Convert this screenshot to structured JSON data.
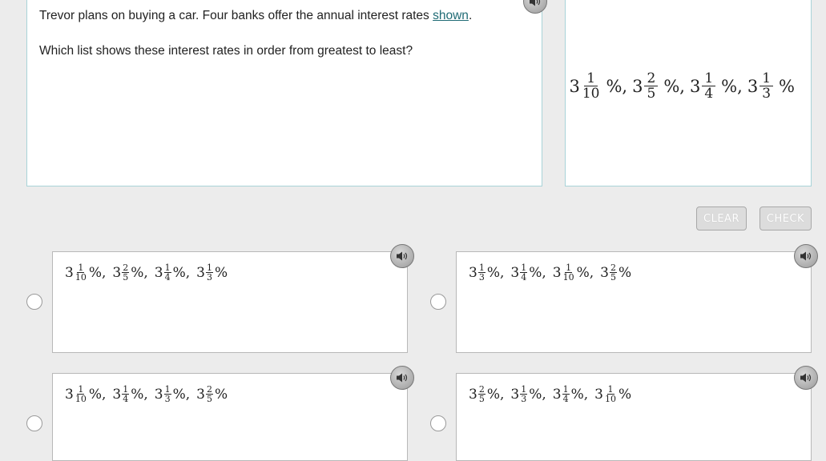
{
  "question": {
    "line1_before": "Trevor plans on buying a car. Four banks offer the annual interest rates ",
    "line1_link": "shown",
    "line1_after": ".",
    "line2": "Which list shows these interest rates in order from greatest to least?"
  },
  "figure": {
    "rates": [
      {
        "whole": "3",
        "num": "1",
        "den": "10",
        "pct": "%",
        "sep": ","
      },
      {
        "whole": "3",
        "num": "2",
        "den": "5",
        "pct": "%",
        "sep": ","
      },
      {
        "whole": "3",
        "num": "1",
        "den": "4",
        "pct": "%",
        "sep": ","
      },
      {
        "whole": "3",
        "num": "1",
        "den": "3",
        "pct": "%",
        "sep": ""
      }
    ]
  },
  "buttons": {
    "clear": "CLEAR",
    "check": "CHECK"
  },
  "choices": [
    {
      "terms": [
        {
          "whole": "3",
          "num": "1",
          "den": "10",
          "pct": "%",
          "sep": ","
        },
        {
          "whole": "3",
          "num": "2",
          "den": "5",
          "pct": "%",
          "sep": ","
        },
        {
          "whole": "3",
          "num": "1",
          "den": "4",
          "pct": "%",
          "sep": ","
        },
        {
          "whole": "3",
          "num": "1",
          "den": "3",
          "pct": "%",
          "sep": ""
        }
      ]
    },
    {
      "terms": [
        {
          "whole": "3",
          "num": "1",
          "den": "3",
          "pct": "%",
          "sep": ","
        },
        {
          "whole": "3",
          "num": "1",
          "den": "4",
          "pct": "%",
          "sep": ","
        },
        {
          "whole": "3",
          "num": "1",
          "den": "10",
          "pct": "%",
          "sep": ","
        },
        {
          "whole": "3",
          "num": "2",
          "den": "5",
          "pct": "%",
          "sep": ""
        }
      ]
    },
    {
      "terms": [
        {
          "whole": "3",
          "num": "1",
          "den": "10",
          "pct": "%",
          "sep": ","
        },
        {
          "whole": "3",
          "num": "1",
          "den": "4",
          "pct": "%",
          "sep": ","
        },
        {
          "whole": "3",
          "num": "1",
          "den": "3",
          "pct": "%",
          "sep": ","
        },
        {
          "whole": "3",
          "num": "2",
          "den": "5",
          "pct": "%",
          "sep": ""
        }
      ]
    },
    {
      "terms": [
        {
          "whole": "3",
          "num": "2",
          "den": "5",
          "pct": "%",
          "sep": ","
        },
        {
          "whole": "3",
          "num": "1",
          "den": "3",
          "pct": "%",
          "sep": ","
        },
        {
          "whole": "3",
          "num": "1",
          "den": "4",
          "pct": "%",
          "sep": ","
        },
        {
          "whole": "3",
          "num": "1",
          "den": "10",
          "pct": "%",
          "sep": ""
        }
      ]
    }
  ],
  "icons": {
    "speaker": "speaker-icon"
  },
  "colors": {
    "panel_border": "#a9d3d8",
    "link": "#1f6b75",
    "background": "#ececec"
  }
}
